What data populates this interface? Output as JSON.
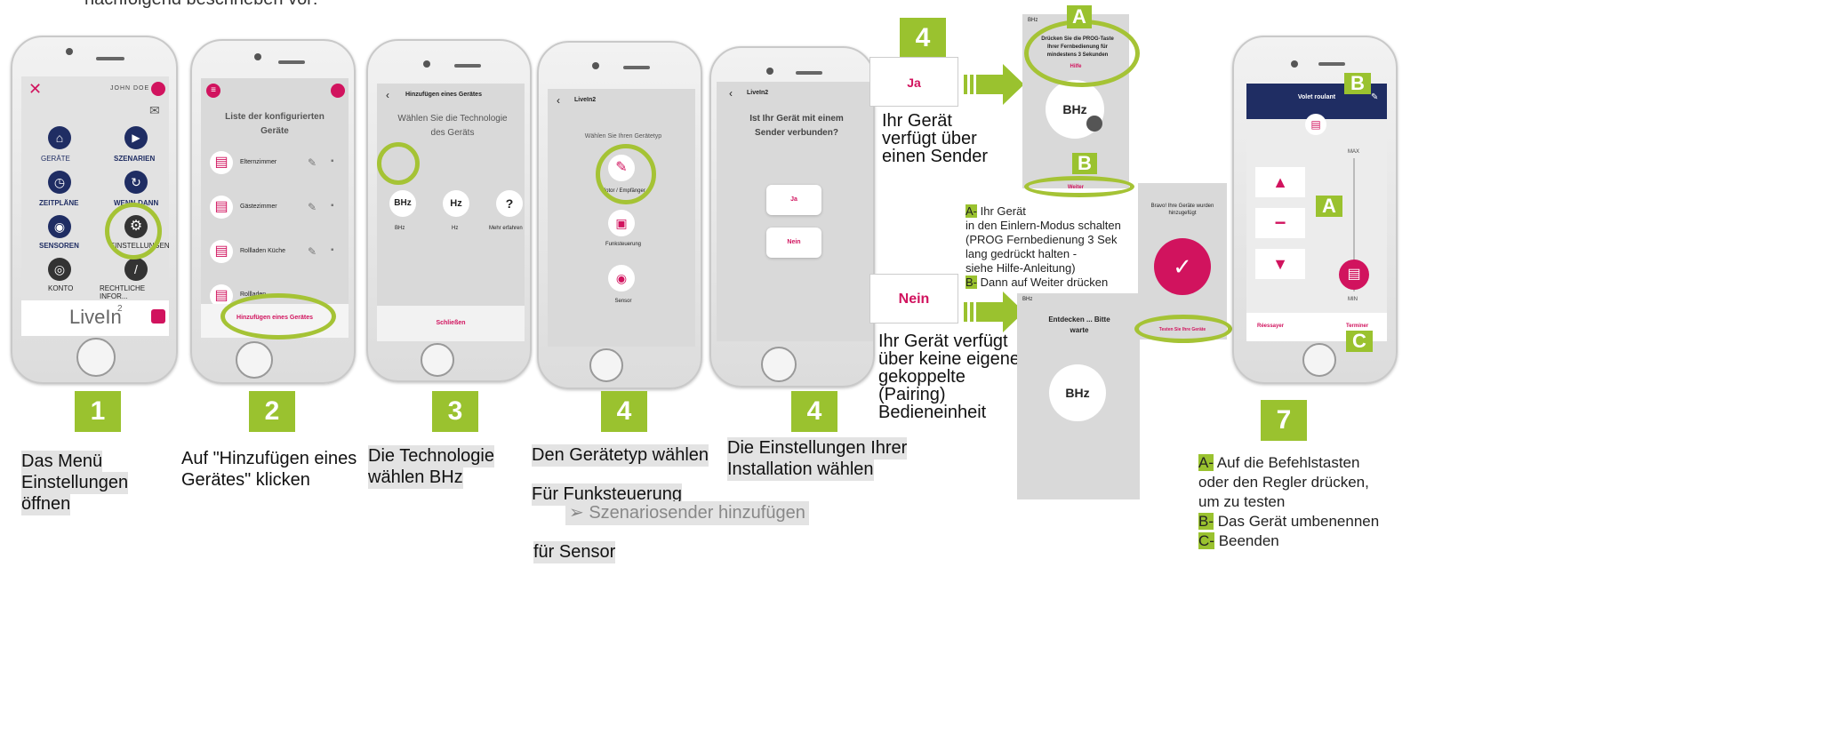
{
  "top_text": "nachfolgend beschrieben vor:",
  "phone1": {
    "user": "JOHN DOE",
    "items": [
      "GERÄTE",
      "SZENARIEN",
      "ZEITPLÄNE",
      "WENN-DANN",
      "SENSOREN",
      "EINSTELLUNGEN",
      "KONTO",
      "RECHTLICHE INFOR..."
    ],
    "brand": "LiveIn",
    "brand_sup": "2"
  },
  "phone2": {
    "title": "Liste der konfigurierten Geräte",
    "rows": [
      "Elternzimmer",
      "Gästezimmer",
      "Rollladen Küche",
      "Rollladen"
    ],
    "add": "Hinzufügen eines Gerätes"
  },
  "phone3": {
    "header": "Hinzufügen eines Gerätes",
    "title": "Wählen Sie die Technologie des Geräts",
    "opts": [
      "BHz",
      "Hz",
      "Mehr erfahren"
    ],
    "close": "Schließen"
  },
  "phone4": {
    "header": "LiveIn2",
    "title": "Wählen Sie Ihren Gerätetyp",
    "opts": [
      "Motor / Empfänger",
      "Funksteuerung",
      "Sensor"
    ]
  },
  "phone5": {
    "header": "LiveIn2",
    "title": "Ist Ihr Gerät mit einem Sender verbunden?",
    "yes": "Ja",
    "no": "Nein"
  },
  "steps": [
    "1",
    "2",
    "3",
    "4",
    "4",
    "4",
    "7"
  ],
  "captions": {
    "c1": [
      "Das Menü",
      "Einstellungen",
      "öffnen"
    ],
    "c2": [
      "Auf \"Hinzufügen eines",
      "Gerätes\" klicken"
    ],
    "c3": [
      "Die Technologie",
      "wählen BHz"
    ],
    "c4a": "Den Gerätetyp wählen",
    "c4b": "Für Funksteuerung",
    "c4c": "➢ Szenariosender hinzufügen",
    "c4d": "für Sensor",
    "c5": [
      "Die Einstellungen Ihrer",
      "Installation wählen"
    ]
  },
  "ja_box": "Ja",
  "ja_text": [
    "Ihr Gerät",
    "verfügt über",
    "einen Sender"
  ],
  "nein_box": "Nein",
  "nein_text": [
    "Ihr Gerät verfügt",
    "über keine eigene",
    "gekoppelte",
    "(Pairing)",
    "Bedieneinheit"
  ],
  "prog": {
    "header": "BHz",
    "text": "Drücken Sie die PROG-Taste Ihrer Fernbedienung für mindestens 3 Sekunden",
    "help": "Hilfe",
    "next": "Weiter"
  },
  "inst": {
    "a_tag": "A-",
    "a": [
      "Ihr Gerät",
      "in den Einlern-Modus schalten",
      "(PROG Fernbedienung 3 Sek",
      "lang gedrückt halten -",
      "siehe Hilfe-Anleitung)"
    ],
    "b_tag": "B-",
    "b": "Dann auf Weiter drücken"
  },
  "disc": {
    "header": "BHz",
    "text": "Entdecken ... Bitte warte"
  },
  "bravo": {
    "text": "Bravo! Ihre Geräte wurden hinzugefügt",
    "btn": "Testen Sie Ihre Geräte"
  },
  "p7": {
    "title": "Volet roulant",
    "max": "MAX",
    "min": "MIN",
    "retry": "Réessayer",
    "done": "Terminer"
  },
  "labels": {
    "A": "A",
    "B": "B",
    "C": "C"
  },
  "c7": {
    "a_tag": "A-",
    "a": [
      "Auf die Befehlstasten",
      "oder den Regler drücken,",
      "um zu testen"
    ],
    "b_tag": "B-",
    "b": "Das Gerät umbenennen",
    "c_tag": "C-",
    "c": "Beenden"
  },
  "colors": {
    "green": "#9ac22f",
    "pink": "#d1135e",
    "navy": "#1f2d63"
  }
}
